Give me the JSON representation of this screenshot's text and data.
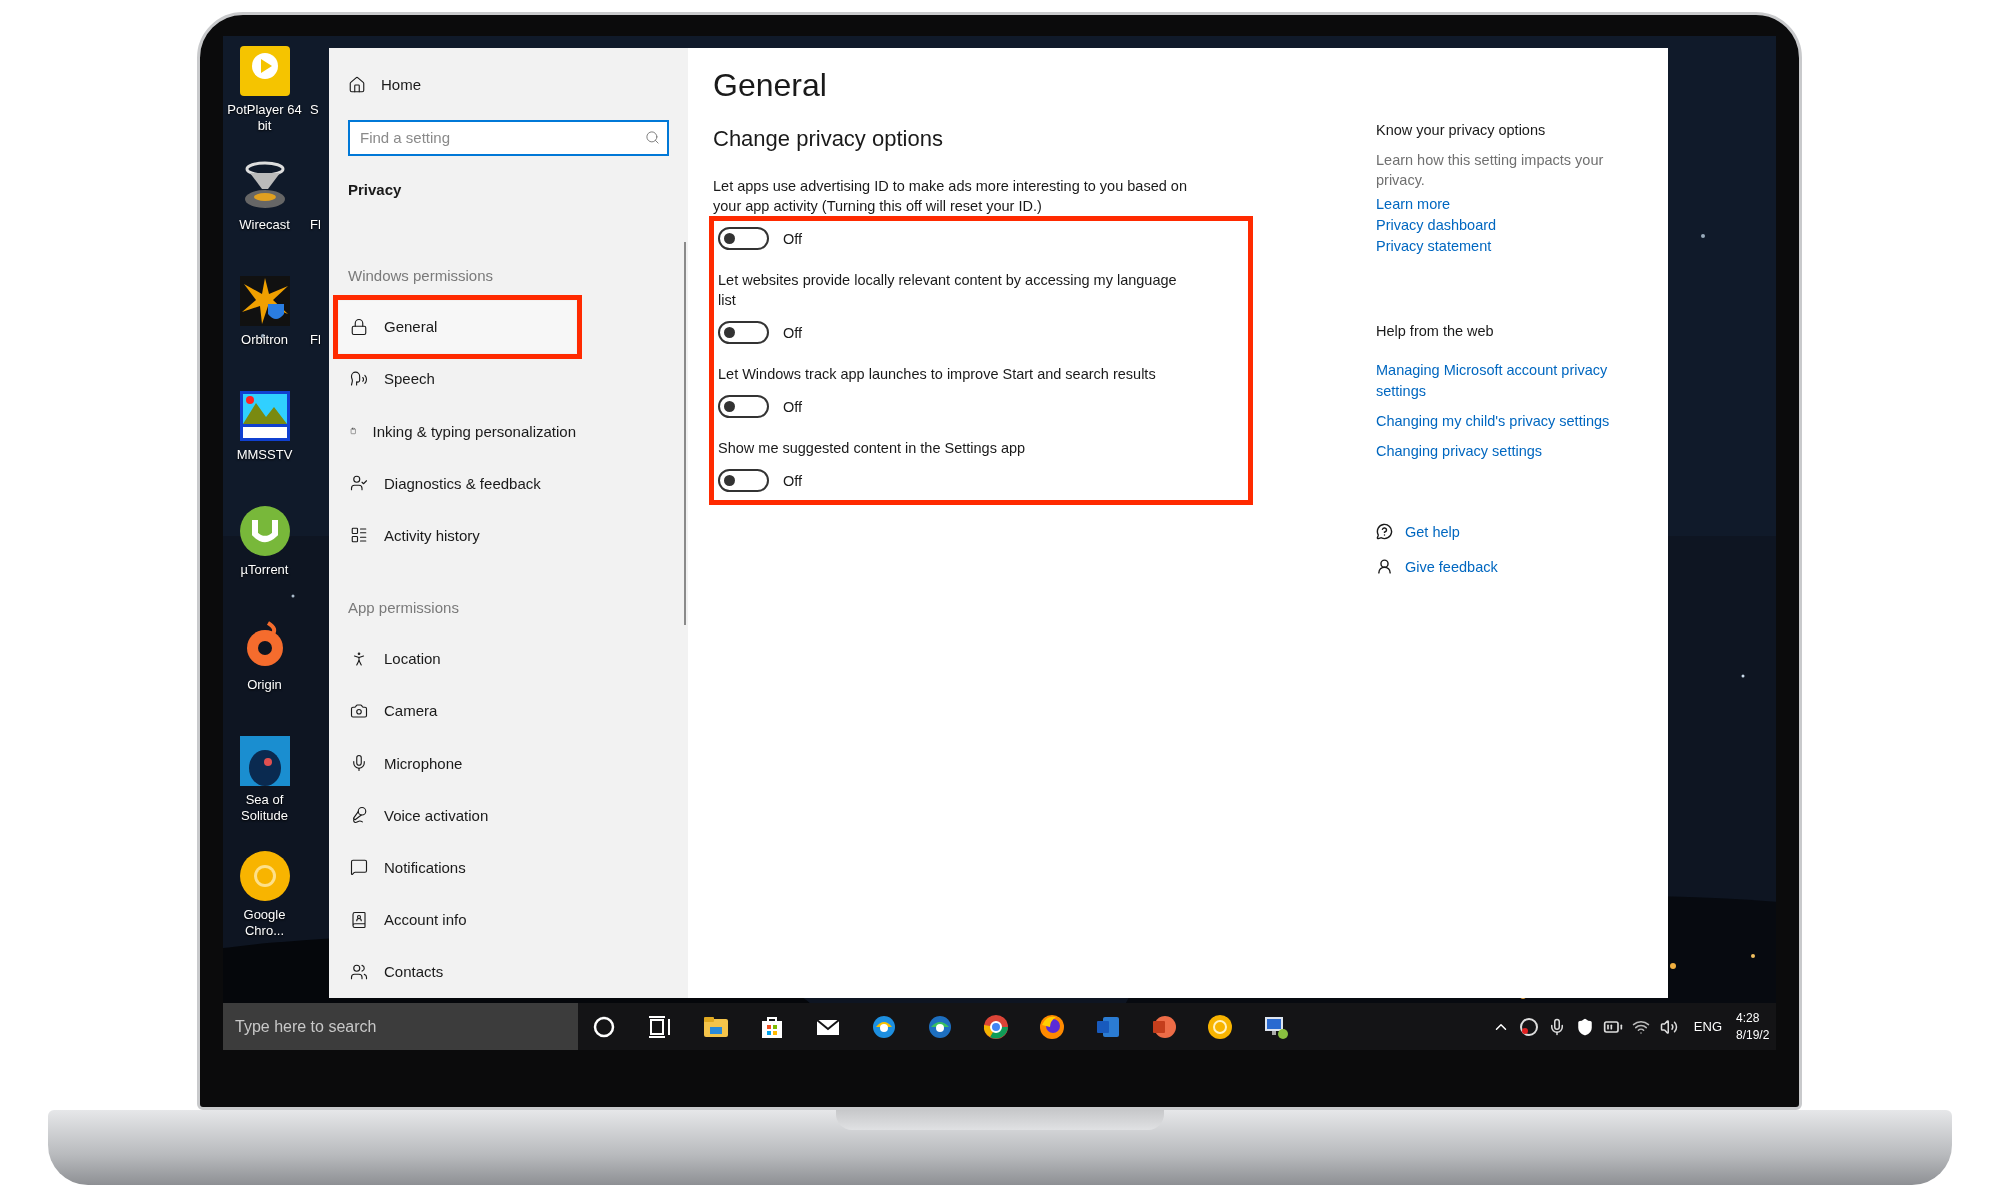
{
  "desktop": {
    "icons": [
      {
        "label": "PotPlayer 64 bit"
      },
      {
        "label": "Wirecast"
      },
      {
        "label": "Orbitron"
      },
      {
        "label": "MMSSTV"
      },
      {
        "label": "µTorrent"
      },
      {
        "label": "Origin"
      },
      {
        "label": "Sea of Solitude"
      },
      {
        "label": "Google Chro..."
      }
    ],
    "hidden_icons": [
      {
        "label": "S"
      },
      {
        "label": "Fl"
      },
      {
        "label": "Fl"
      }
    ]
  },
  "settings_window": {
    "sidebar": {
      "home": "Home",
      "search": {
        "placeholder": "Find a setting"
      },
      "section": "Privacy",
      "groups": [
        {
          "heading": "Windows permissions",
          "items": [
            {
              "label": "General",
              "selected": true
            },
            {
              "label": "Speech",
              "selected": false
            },
            {
              "label": "Inking & typing personalization",
              "selected": false
            },
            {
              "label": "Diagnostics & feedback",
              "selected": false
            },
            {
              "label": "Activity history",
              "selected": false
            }
          ]
        },
        {
          "heading": "App permissions",
          "items": [
            {
              "label": "Location",
              "selected": false
            },
            {
              "label": "Camera",
              "selected": false
            },
            {
              "label": "Microphone",
              "selected": false
            },
            {
              "label": "Voice activation",
              "selected": false
            },
            {
              "label": "Notifications",
              "selected": false
            },
            {
              "label": "Account info",
              "selected": false
            },
            {
              "label": "Contacts",
              "selected": false
            }
          ]
        }
      ]
    },
    "page": {
      "title": "General",
      "subtitle": "Change privacy options",
      "highlight_box": true,
      "options": [
        {
          "description": "Let apps use advertising ID to make ads more interesting to you based on your app activity (Turning this off will reset your ID.)",
          "on": false,
          "state": "Off"
        },
        {
          "description": "Let websites provide locally relevant content by accessing my language list",
          "on": false,
          "state": "Off"
        },
        {
          "description": "Let Windows track app launches to improve Start and search results",
          "on": false,
          "state": "Off"
        },
        {
          "description": "Show me suggested content in the Settings app",
          "on": false,
          "state": "Off"
        }
      ]
    },
    "aside": {
      "know": {
        "heading": "Know your privacy options",
        "text": "Learn how this setting impacts your privacy.",
        "links": [
          "Learn more",
          "Privacy dashboard",
          "Privacy statement"
        ]
      },
      "help": {
        "heading": "Help from the web",
        "links": [
          "Managing Microsoft account privacy settings",
          "Changing my child's privacy settings",
          "Changing privacy settings"
        ]
      },
      "actions": [
        {
          "label": "Get help"
        },
        {
          "label": "Give feedback"
        }
      ]
    }
  },
  "taskbar": {
    "search": {
      "placeholder": "Type here to search"
    },
    "language": "ENG",
    "time": "4:28",
    "date": "8/19/2"
  }
}
